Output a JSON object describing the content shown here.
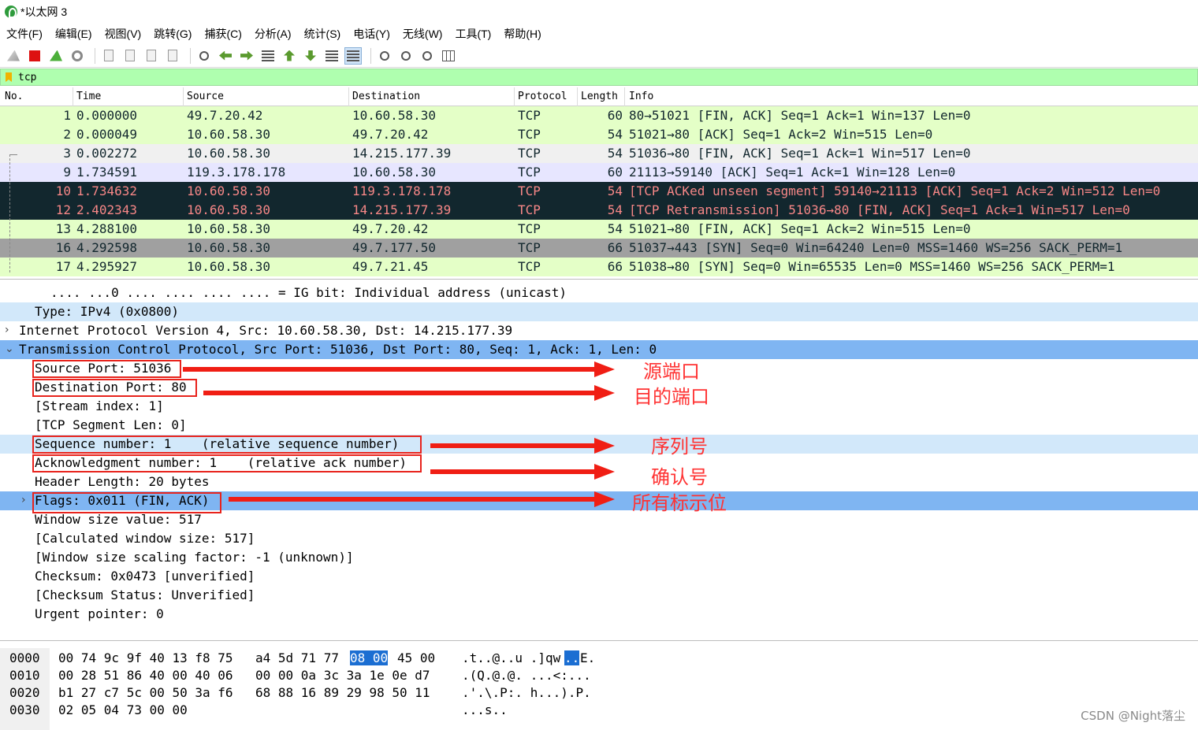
{
  "window": {
    "title": "*以太网 3"
  },
  "menu": [
    "文件(F)",
    "编辑(E)",
    "视图(V)",
    "跳转(G)",
    "捕获(C)",
    "分析(A)",
    "统计(S)",
    "电话(Y)",
    "无线(W)",
    "工具(T)",
    "帮助(H)"
  ],
  "toolbar": {
    "icons": [
      "shark-fin-icon",
      "stop-capture-icon",
      "restart-capture-icon",
      "capture-options-icon",
      "open-file-icon",
      "save-file-icon",
      "close-file-icon",
      "reload-file-icon",
      "find-packet-icon",
      "go-back-icon",
      "go-forward-icon",
      "go-to-packet-icon",
      "go-first-icon",
      "go-last-icon",
      "auto-scroll-icon",
      "colorize-icon",
      "zoom-in-icon",
      "zoom-out-icon",
      "zoom-normal-icon",
      "resize-columns-icon"
    ]
  },
  "filter": {
    "value": "tcp",
    "bg_color": "#afffaf"
  },
  "packet_list": {
    "columns": [
      "No.",
      "Time",
      "Source",
      "Destination",
      "Protocol",
      "Length",
      "Info"
    ],
    "rows": [
      {
        "no": "1",
        "time": "0.000000",
        "src": "49.7.20.42",
        "dst": "10.60.58.30",
        "proto": "TCP",
        "len": "60",
        "info": "80→51021 [FIN, ACK] Seq=1 Ack=1 Win=137 Len=0",
        "bg": "#e4ffc7",
        "fg": "#12272e"
      },
      {
        "no": "2",
        "time": "0.000049",
        "src": "10.60.58.30",
        "dst": "49.7.20.42",
        "proto": "TCP",
        "len": "54",
        "info": "51021→80 [ACK] Seq=1 Ack=2 Win=515 Len=0",
        "bg": "#e4ffc7",
        "fg": "#12272e"
      },
      {
        "no": "3",
        "time": "0.002272",
        "src": "10.60.58.30",
        "dst": "14.215.177.39",
        "proto": "TCP",
        "len": "54",
        "info": "51036→80 [FIN, ACK] Seq=1 Ack=1 Win=517 Len=0",
        "bg": "#f0f0f0",
        "fg": "#12272e"
      },
      {
        "no": "9",
        "time": "1.734591",
        "src": "119.3.178.178",
        "dst": "10.60.58.30",
        "proto": "TCP",
        "len": "60",
        "info": "21113→59140 [ACK] Seq=1 Ack=1 Win=128 Len=0",
        "bg": "#e7e6ff",
        "fg": "#12272e"
      },
      {
        "no": "10",
        "time": "1.734632",
        "src": "10.60.58.30",
        "dst": "119.3.178.178",
        "proto": "TCP",
        "len": "54",
        "info": "[TCP ACKed unseen segment] 59140→21113 [ACK] Seq=1 Ack=2 Win=512 Len=0",
        "bg": "#12272e",
        "fg": "#f78787"
      },
      {
        "no": "12",
        "time": "2.402343",
        "src": "10.60.58.30",
        "dst": "14.215.177.39",
        "proto": "TCP",
        "len": "54",
        "info": "[TCP Retransmission] 51036→80 [FIN, ACK] Seq=1 Ack=1 Win=517 Len=0",
        "bg": "#12272e",
        "fg": "#f78787"
      },
      {
        "no": "13",
        "time": "4.288100",
        "src": "10.60.58.30",
        "dst": "49.7.20.42",
        "proto": "TCP",
        "len": "54",
        "info": "51021→80 [FIN, ACK] Seq=1 Ack=2 Win=515 Len=0",
        "bg": "#e4ffc7",
        "fg": "#12272e"
      },
      {
        "no": "16",
        "time": "4.292598",
        "src": "10.60.58.30",
        "dst": "49.7.177.50",
        "proto": "TCP",
        "len": "66",
        "info": "51037→443 [SYN] Seq=0 Win=64240 Len=0 MSS=1460 WS=256 SACK_PERM=1",
        "bg": "#a0a0a0",
        "fg": "#12272e"
      },
      {
        "no": "17",
        "time": "4.295927",
        "src": "10.60.58.30",
        "dst": "49.7.21.45",
        "proto": "TCP",
        "len": "66",
        "info": "51038→80 [SYN] Seq=0 Win=65535 Len=0 MSS=1460 WS=256 SACK_PERM=1",
        "bg": "#e4ffc7",
        "fg": "#12272e"
      }
    ]
  },
  "details": {
    "lines": [
      {
        "text": ".... ...0 .... .... .... .... = IG bit: Individual address (unicast)",
        "bg": "#ffffff",
        "chevron": ""
      },
      {
        "text": "Type: IPv4 (0x0800)",
        "bg": "#d2e8fa",
        "chevron": ""
      },
      {
        "text": "Internet Protocol Version 4, Src: 10.60.58.30, Dst: 14.215.177.39",
        "bg": "#ffffff",
        "chevron": "›"
      },
      {
        "text": "Transmission Control Protocol, Src Port: 51036, Dst Port: 80, Seq: 1, Ack: 1, Len: 0",
        "bg": "#7fb5f2",
        "chevron": "⌄"
      },
      {
        "text": "Source Port: 51036",
        "bg": "#ffffff",
        "chevron": ""
      },
      {
        "text": "Destination Port: 80",
        "bg": "#ffffff",
        "chevron": ""
      },
      {
        "text": "[Stream index: 1]",
        "bg": "#ffffff",
        "chevron": ""
      },
      {
        "text": "[TCP Segment Len: 0]",
        "bg": "#ffffff",
        "chevron": ""
      },
      {
        "text": "Sequence number: 1    (relative sequence number)",
        "bg": "#d2e8fa",
        "chevron": ""
      },
      {
        "text": "Acknowledgment number: 1    (relative ack number)",
        "bg": "#ffffff",
        "chevron": ""
      },
      {
        "text": "Header Length: 20 bytes",
        "bg": "#ffffff",
        "chevron": ""
      },
      {
        "text": "Flags: 0x011 (FIN, ACK)",
        "bg": "#7fb5f2",
        "chevron": "›"
      },
      {
        "text": "Window size value: 517",
        "bg": "#ffffff",
        "chevron": ""
      },
      {
        "text": "[Calculated window size: 517]",
        "bg": "#ffffff",
        "chevron": ""
      },
      {
        "text": "[Window size scaling factor: -1 (unknown)]",
        "bg": "#ffffff",
        "chevron": ""
      },
      {
        "text": "Checksum: 0x0473 [unverified]",
        "bg": "#ffffff",
        "chevron": ""
      },
      {
        "text": "[Checksum Status: Unverified]",
        "bg": "#ffffff",
        "chevron": ""
      },
      {
        "text": "Urgent pointer: 0",
        "bg": "#ffffff",
        "chevron": ""
      }
    ]
  },
  "annotations": {
    "source_port": "源端口",
    "destination_port": "目的端口",
    "sequence_number": "序列号",
    "ack_number": "确认号",
    "flags": "所有标示位"
  },
  "hex": {
    "rows": [
      {
        "offset": "0000",
        "bytes_a": "00 74 9c 9f 40 13 f8 75",
        "bytes_b1": "a4 5d 71 77",
        "bytes_hl": "08 00",
        "bytes_b2": "45 00",
        "ascii_a": ".t..@..u .]qw",
        "ascii_hl": "..",
        "ascii_b": "E."
      },
      {
        "offset": "0010",
        "bytes_a": "00 28 51 86 40 00 40 06",
        "bytes_b1": "00 00 0a 3c 3a 1e 0e d7",
        "bytes_hl": "",
        "bytes_b2": "",
        "ascii_a": ".(Q.@.@. ...<:...",
        "ascii_hl": "",
        "ascii_b": ""
      },
      {
        "offset": "0020",
        "bytes_a": "b1 27 c7 5c 00 50 3a f6",
        "bytes_b1": "68 88 16 89 29 98 50 11",
        "bytes_hl": "",
        "bytes_b2": "",
        "ascii_a": ".'.\\.P:. h...).P.",
        "ascii_hl": "",
        "ascii_b": ""
      },
      {
        "offset": "0030",
        "bytes_a": "02 05 04 73 00 00",
        "bytes_b1": "",
        "bytes_hl": "",
        "bytes_b2": "",
        "ascii_a": "...s..",
        "ascii_hl": "",
        "ascii_b": ""
      }
    ]
  },
  "watermark": "CSDN @Night落尘",
  "colors": {
    "annotation_red": "#e8231c",
    "selected_blue": "#7fb5f2",
    "hex_highlight": "#1b6ed2"
  }
}
